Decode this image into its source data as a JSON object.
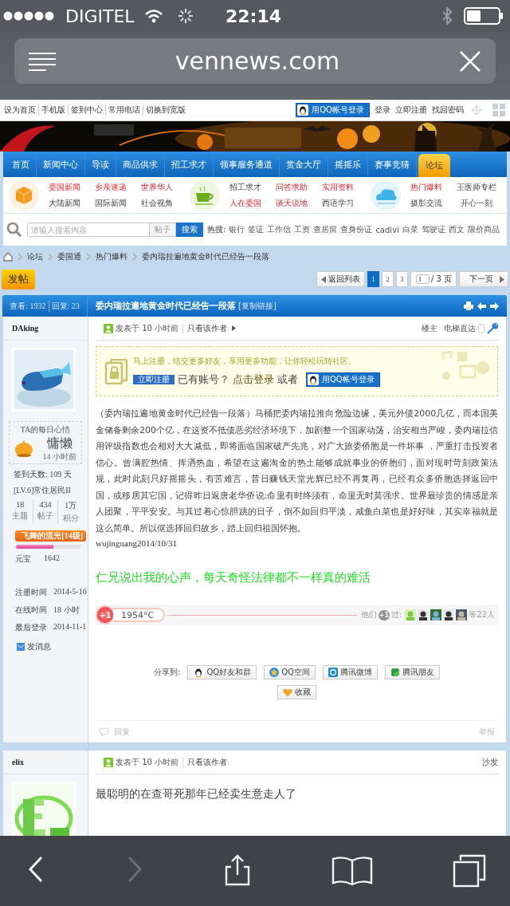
{
  "status_bar": {
    "carrier": "DIGITEL",
    "time": "22:14"
  },
  "browser": {
    "url": "vennews.com"
  },
  "top_links": [
    "设为首页",
    "手机版",
    "签到中心",
    "常用电话",
    "切换到宽版"
  ],
  "qq_login": "用QQ帐号登录",
  "account_links": [
    "登录",
    "立即注册",
    "找回密码"
  ],
  "nav": [
    {
      "label": "首页",
      "selected": false
    },
    {
      "label": "新闻中心",
      "selected": false
    },
    {
      "label": "导读",
      "selected": false
    },
    {
      "label": "商品供求",
      "selected": false
    },
    {
      "label": "招工求才",
      "selected": false
    },
    {
      "label": "领事服务通道",
      "selected": false
    },
    {
      "label": "赏金大厅",
      "selected": false
    },
    {
      "label": "摇摇乐",
      "selected": false
    },
    {
      "label": "赛事竞猜",
      "selected": false
    },
    {
      "label": "论坛",
      "selected": true
    }
  ],
  "subnav": [
    {
      "columns": [
        {
          "links": [
            {
              "label": "委国新闻",
              "hot": true
            },
            {
              "label": "大陆新闻",
              "hot": false
            }
          ]
        },
        {
          "links": [
            {
              "label": "乡亲速递",
              "hot": true
            },
            {
              "label": "国际新闻",
              "hot": false
            }
          ]
        },
        {
          "links": [
            {
              "label": "世界华人",
              "hot": true
            },
            {
              "label": "社会视角",
              "hot": false
            }
          ]
        }
      ]
    },
    {
      "columns": [
        {
          "links": [
            {
              "label": "招工求才",
              "hot": false
            },
            {
              "label": "人在委国",
              "hot": true
            }
          ]
        },
        {
          "links": [
            {
              "label": "问答求助",
              "hot": true
            },
            {
              "label": "谈天说地",
              "hot": true
            }
          ]
        },
        {
          "links": [
            {
              "label": "实用资料",
              "hot": true
            },
            {
              "label": "西语学习",
              "hot": false
            }
          ]
        }
      ]
    },
    {
      "columns": [
        {
          "links": [
            {
              "label": "热门爆料",
              "hot": true
            },
            {
              "label": "摄影交流",
              "hot": false
            }
          ]
        },
        {
          "links": [
            {
              "label": "王医师专栏",
              "hot": false
            },
            {
              "label": "开心一刻",
              "hot": false
            }
          ]
        }
      ]
    }
  ],
  "search": {
    "placeholder": "请输入搜索内容",
    "scope": "帖子",
    "button": "搜索",
    "hot_label": "热搜:",
    "hot_terms": [
      "银行",
      "签证",
      "工作信",
      "工资",
      "查居留",
      "查身份证",
      "cadivi",
      "白菜",
      "驾驶证",
      "西文",
      "限价商品"
    ]
  },
  "breadcrumb": [
    "论坛",
    "委国通",
    "热门爆料",
    "委内瑞拉遍地黄金时代已经告一段落"
  ],
  "post_button": "发帖",
  "pagination": {
    "back": "返回列表",
    "pages": [
      {
        "label": "1",
        "selected": true
      },
      {
        "label": "2",
        "selected": false
      },
      {
        "label": "3",
        "selected": false
      }
    ],
    "page_input": "1",
    "page_total": "/ 3 页",
    "next": "下一页"
  },
  "thread": {
    "views": "查看: 1932",
    "replies": "回复: 23",
    "title": "委内瑞拉遍地黄金时代已经告一段落",
    "copy_link": "[复制链接]"
  },
  "posts": [
    {
      "author": "DAking",
      "profile": {
        "mood_title": "TA的每日心情",
        "mood": "慵懒",
        "mood_time": "14 小时前",
        "checkin": "签到天数: 109 天",
        "rank": "[LV.6]常住居民II",
        "stats": [
          {
            "value": "18",
            "label": "主题"
          },
          {
            "value": "434",
            "label": "帖子"
          },
          {
            "value": "1万",
            "label": "积分"
          }
        ],
        "medal": {
          "label": "飞舞的流光[14级]",
          "level": 0.57
        },
        "currency": {
          "label": "元宝",
          "value": "1642"
        },
        "info": [
          {
            "label": "注册时间",
            "value": "2014-5-16"
          },
          {
            "label": "在线时间",
            "value": "18 小时"
          },
          {
            "label": "最后登录",
            "value": "2014-11-1"
          }
        ],
        "message": "发消息"
      },
      "posted": "发表于 10 小时前",
      "author_only": "只看该作者",
      "floor": "楼主",
      "jump": "电梯直达",
      "notice": {
        "headline": "马上注册，结交更多好友，享用更多功能，让你轻松玩转社区。",
        "register": "立即注册",
        "have_account": "已有账号？",
        "login": "点击登录",
        "or": "或者",
        "qq_login": "用QQ帐号登录"
      },
      "body": "（委内瑞拉遍地黄金时代已经告一段落）马桶把委内瑞拉推向危险边缘，美元外债2000几亿，而本国美金储备剩余200个亿，在这资不抵债恶劣经济环境下，加剧整一个国家动荡，治安相当严峻，委内瑞拉信用评级指数也会相对大大减低，即将面临国家破产先兆，对广大旅委侨胞是一件坏事 ，严重打击投资者信心。曾满腔热情、挥洒热血，希望在这遍淘金的热土能够成就事业的侨胞们，面对现时苛刻政策法规，此时此刻只好摇摇头，有苦难言，昔日赚钱天堂光辉已经不再复再，已经有众多侨胞选择返回中国，或移居其它国，记得昨日返唐老华侨说:命里有时终须有，命里无时莫强求。世界最珍贵的情感是亲人团聚，平平安安。与其过着心惊胆跳的日子，倒不如回归平淡，咸鱼白菜也是好好味，其实幸福就是这么简单。所以伛选择回归故乡，踏上回归祖国怀抱。",
      "signature": "wujinguang2014/10/31",
      "comment": "仁兄说出我的心声，每天奇怪法律都不一样真的难活",
      "rate": {
        "button": "+1",
        "heat": "1954°C",
        "they": "他们",
        "plus": "+1",
        "past": "过:",
        "more": "等22人"
      },
      "share": {
        "label": "分享到:",
        "buttons": [
          "QQ好友和群",
          "QQ空间",
          "腾讯微博",
          "腾讯朋友"
        ],
        "favorite": "收藏"
      },
      "footer": {
        "reply": "回复",
        "report": "举报"
      }
    },
    {
      "author": "elix",
      "posted": "发表于 10 小时前",
      "author_only": "只看该作者",
      "floor": "沙发",
      "body": "最聪明的在查哥死那年已经卖生意走人了"
    }
  ],
  "toolbar": [
    {
      "kind": "back",
      "disabled": false
    },
    {
      "kind": "forward",
      "disabled": true
    },
    {
      "kind": "share",
      "disabled": false
    },
    {
      "kind": "bookmarks",
      "disabled": false
    },
    {
      "kind": "tabs",
      "disabled": false
    }
  ]
}
